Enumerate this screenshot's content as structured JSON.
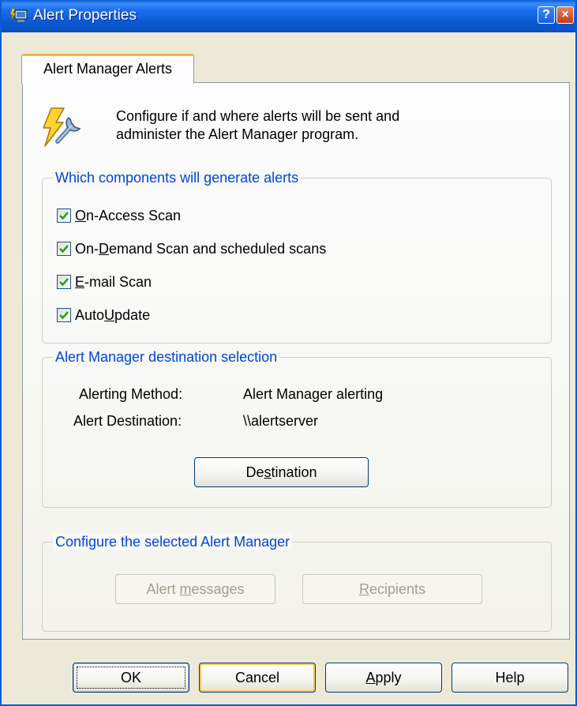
{
  "window": {
    "title": "Alert Properties",
    "title_icon": "computer-alert-icon"
  },
  "title_buttons": {
    "help": "?",
    "close": "×"
  },
  "tab": {
    "label": "Alert Manager Alerts"
  },
  "header": {
    "icon": "lightning-wrench-icon",
    "line1": "Configure if and where alerts will be sent and",
    "line2": "administer the Alert Manager program."
  },
  "components_group": {
    "title": "Which components will generate alerts",
    "items": [
      {
        "pre": "",
        "accel": "O",
        "post": "n-Access Scan",
        "checked": true
      },
      {
        "pre": "On-",
        "accel": "D",
        "post": "emand Scan and scheduled scans",
        "checked": true
      },
      {
        "pre": "",
        "accel": "E",
        "post": "-mail Scan",
        "checked": true
      },
      {
        "pre": "Auto",
        "accel": "U",
        "post": "pdate",
        "checked": true
      }
    ]
  },
  "destination_group": {
    "title": "Alert Manager destination selection",
    "method_label": "Alerting Method:",
    "method_value": "Alert Manager alerting",
    "dest_label": "Alert Destination:",
    "dest_value": "\\\\alertserver",
    "button": {
      "pre": "De",
      "accel": "s",
      "post": "tination"
    }
  },
  "configure_group": {
    "title": "Configure the selected Alert Manager",
    "messages_button": {
      "pre": "Alert ",
      "accel": "m",
      "post": "essages"
    },
    "recipients_button": {
      "pre": "",
      "accel": "R",
      "post": "ecipients"
    }
  },
  "footer": {
    "ok": "OK",
    "cancel": "Cancel",
    "apply": {
      "pre": "",
      "accel": "A",
      "post": "pply"
    },
    "help": "Help"
  },
  "colors": {
    "titlebar": "#0a58d0",
    "group_title": "#0046d5",
    "tab_highlight": "#f7b63c",
    "check": "#21a121"
  }
}
